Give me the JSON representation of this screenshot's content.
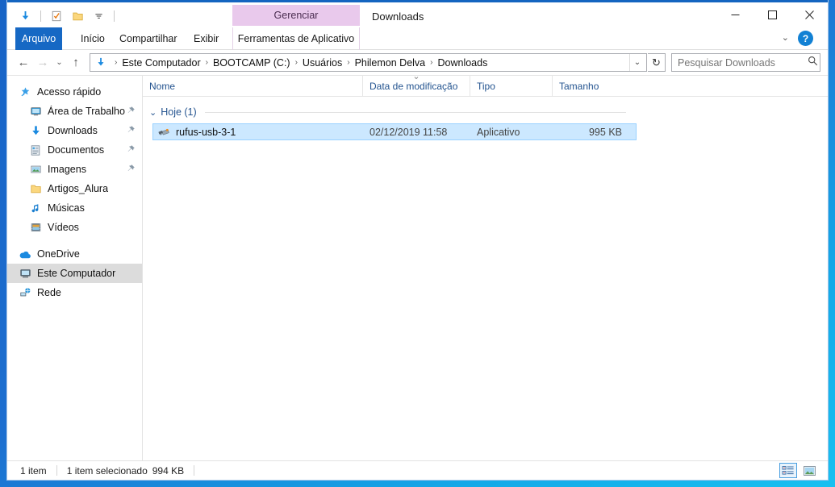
{
  "window": {
    "title": "Downloads",
    "accent_color": "#1668c4",
    "selection_color": "#cce8ff",
    "contextual_tab_color": "#e9c9ec"
  },
  "quick_access_toolbar": {
    "items": [
      {
        "name": "downloads-folder-icon",
        "label": "Downloads"
      },
      {
        "name": "properties-icon",
        "label": "Propriedades"
      },
      {
        "name": "new-folder-icon",
        "label": "Nova pasta"
      },
      {
        "name": "customize-chevron-icon",
        "label": "Personalizar Barra de Ferramentas de Acesso Rápido"
      }
    ]
  },
  "window_controls": {
    "minimize": "—",
    "maximize": "▢",
    "close": "✕",
    "ribbon_collapse": "⌄",
    "help": "?"
  },
  "ribbon": {
    "contextual_group": "Gerenciar",
    "tabs": [
      {
        "label": "Arquivo",
        "active": true
      },
      {
        "label": "Início",
        "active": false
      },
      {
        "label": "Compartilhar",
        "active": false
      },
      {
        "label": "Exibir",
        "active": false
      }
    ],
    "contextual_tab": "Ferramentas de Aplicativo"
  },
  "navigation": {
    "back": "←",
    "forward": "→",
    "recent": "⌄",
    "up": "↑",
    "address_icon": "downloads-arrow-icon",
    "breadcrumbs": [
      "Este Computador",
      "BOOTCAMP (C:)",
      "Usuários",
      "Philemon Delva",
      "Downloads"
    ],
    "separator": "›",
    "dropdown": "⌄",
    "refresh": "↻"
  },
  "search": {
    "placeholder": "Pesquisar Downloads",
    "value": "",
    "icon": "search-icon"
  },
  "sidebar": {
    "items": [
      {
        "label": "Acesso rápido",
        "icon": "star-pin-icon",
        "indent": false,
        "pinned": false,
        "selected": false
      },
      {
        "label": "Área de Trabalho",
        "icon": "desktop-icon",
        "indent": true,
        "pinned": true,
        "selected": false
      },
      {
        "label": "Downloads",
        "icon": "downloads-arrow-icon",
        "indent": true,
        "pinned": true,
        "selected": false
      },
      {
        "label": "Documentos",
        "icon": "documents-icon",
        "indent": true,
        "pinned": true,
        "selected": false
      },
      {
        "label": "Imagens",
        "icon": "pictures-icon",
        "indent": true,
        "pinned": true,
        "selected": false
      },
      {
        "label": "Artigos_Alura",
        "icon": "folder-icon",
        "indent": true,
        "pinned": false,
        "selected": false
      },
      {
        "label": "Músicas",
        "icon": "music-note-icon",
        "indent": true,
        "pinned": false,
        "selected": false
      },
      {
        "label": "Vídeos",
        "icon": "video-icon",
        "indent": true,
        "pinned": false,
        "selected": false
      },
      {
        "label": "OneDrive",
        "icon": "cloud-icon",
        "indent": false,
        "pinned": false,
        "selected": false
      },
      {
        "label": "Este Computador",
        "icon": "this-pc-icon",
        "indent": false,
        "pinned": false,
        "selected": true
      },
      {
        "label": "Rede",
        "icon": "network-icon",
        "indent": false,
        "pinned": false,
        "selected": false
      }
    ]
  },
  "file_list": {
    "columns": [
      {
        "label": "Nome",
        "sorted": false
      },
      {
        "label": "Data de modificação",
        "sorted": true
      },
      {
        "label": "Tipo",
        "sorted": false
      },
      {
        "label": "Tamanho",
        "sorted": false
      }
    ],
    "groups": [
      {
        "label": "Hoje (1)",
        "chevron": "⌄",
        "rows": [
          {
            "name": "rufus-usb-3-1",
            "icon": "rufus-usb-icon",
            "date": "02/12/2019 11:58",
            "type": "Aplicativo",
            "size": "995 KB",
            "selected": true
          }
        ]
      }
    ]
  },
  "status_bar": {
    "item_count": "1 item",
    "selection": "1 item selecionado",
    "selection_size": "994 KB",
    "views": [
      {
        "name": "details-view-button",
        "active": true
      },
      {
        "name": "large-icons-view-button",
        "active": false
      }
    ]
  }
}
